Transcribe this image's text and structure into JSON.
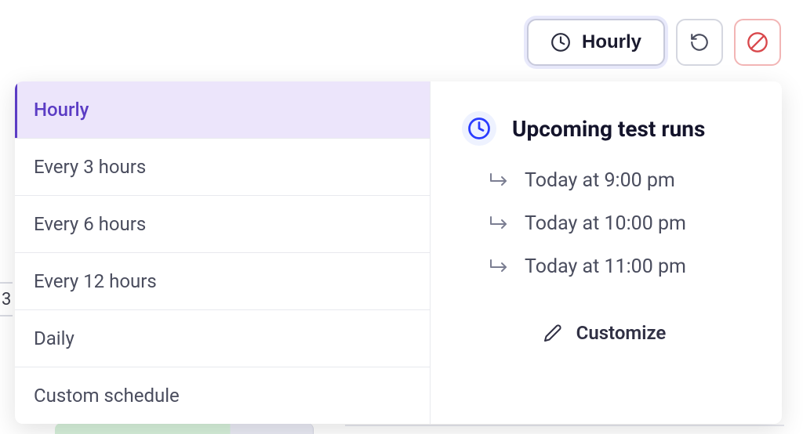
{
  "toolbar": {
    "schedule_label": "Hourly"
  },
  "options": [
    {
      "label": "Hourly",
      "selected": true
    },
    {
      "label": "Every 3 hours",
      "selected": false
    },
    {
      "label": "Every 6 hours",
      "selected": false
    },
    {
      "label": "Every 12 hours",
      "selected": false
    },
    {
      "label": "Daily",
      "selected": false
    },
    {
      "label": "Custom schedule",
      "selected": false
    }
  ],
  "preview": {
    "title": "Upcoming test runs",
    "runs": [
      "Today at 9:00 pm",
      "Today at 10:00 pm",
      "Today at 11:00 pm"
    ],
    "customize_label": "Customize"
  },
  "bg_hint": "3"
}
